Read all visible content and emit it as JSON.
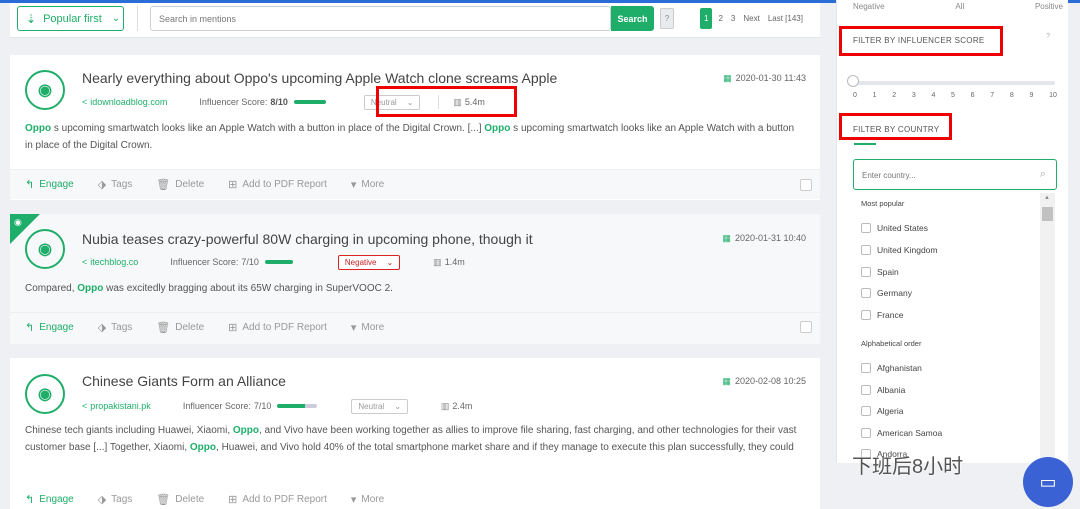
{
  "toolbar": {
    "sort_label": "Popular first",
    "search_placeholder": "Search in mentions",
    "search_button": "Search",
    "help": "?",
    "pages": [
      "1",
      "2",
      "3"
    ],
    "next": "Next",
    "last": "Last [143]"
  },
  "mentions": [
    {
      "title": "Nearly everything about Oppo's upcoming Apple Watch clone screams Apple",
      "source": "idownloadblog.com",
      "influencer_label": "Influencer Score:",
      "influencer_score": "8/10",
      "sentiment": "Neutral",
      "reach": "5.4m",
      "date": "2020-01-30 11:43",
      "text_parts": [
        "Oppo",
        " s upcoming smartwatch looks like an Apple Watch with a button in place of the Digital Crown. [...] ",
        "Oppo",
        " s upcoming smartwatch looks like an Apple Watch with a button in place of the Digital Crown."
      ]
    },
    {
      "title": "Nubia teases crazy-powerful 80W charging in upcoming phone, though it",
      "source": "itechblog.co",
      "influencer_label": "Influencer Score:",
      "influencer_score": "7/10",
      "sentiment": "Negative",
      "reach": "1.4m",
      "date": "2020-01-31 10:40",
      "text_parts": [
        "Compared, ",
        "Oppo",
        " was excitedly bragging about its 65W charging in SuperVOOC 2."
      ]
    },
    {
      "title": "Chinese Giants Form an Alliance",
      "source": "propakistani.pk",
      "influencer_label": "Influencer Score:",
      "influencer_score": "7/10",
      "sentiment": "Neutral",
      "reach": "2.4m",
      "date": "2020-02-08 10:25",
      "text_parts": [
        "Chinese tech giants including Huawei, Xiaomi, ",
        "Oppo",
        ", and Vivo have been working together as allies to improve file sharing, fast charging, and other technologies for their vast customer base [...] Together, Xiaomi, ",
        "Oppo",
        ", Huawei, and Vivo hold 40% of the total smartphone market share and if they manage to execute this plan successfully, they could"
      ]
    }
  ],
  "actions": {
    "engage": "Engage",
    "tags": "Tags",
    "delete": "Delete",
    "pdf": "Add to PDF Report",
    "more": "More"
  },
  "sidebar": {
    "sentiment_labels": [
      "Negative",
      "All",
      "Positive"
    ],
    "influencer_title": "FILTER BY INFLUENCER SCORE",
    "help": "?",
    "score_ticks": [
      "0",
      "1",
      "2",
      "3",
      "4",
      "5",
      "6",
      "7",
      "8",
      "9",
      "10"
    ],
    "country_title": "FILTER BY COUNTRY",
    "country_placeholder": "Enter country...",
    "most_popular_label": "Most popular",
    "popular_countries": [
      "United States",
      "United Kingdom",
      "Spain",
      "Germany",
      "France"
    ],
    "alphabetical_label": "Alphabetical order",
    "alpha_countries": [
      "Afghanistan",
      "Albania",
      "Algeria",
      "American Samoa",
      "Andorra"
    ]
  },
  "watermark": "下班后8小时",
  "colors": {
    "accent": "#1fae6a",
    "highlight_box": "#e00000",
    "chat": "#3a62d4"
  }
}
